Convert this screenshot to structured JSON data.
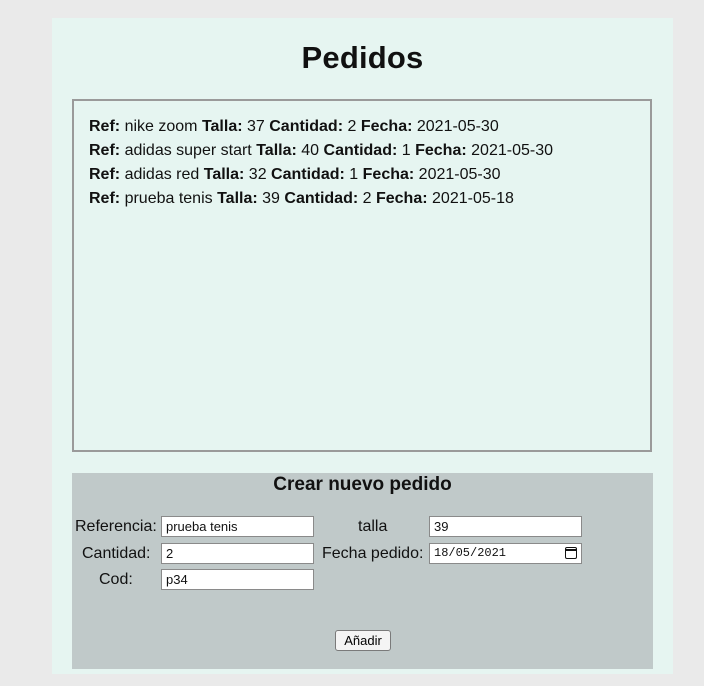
{
  "page": {
    "title": "Pedidos"
  },
  "orders": [
    {
      "ref_label": "Ref:",
      "ref": "nike zoom",
      "talla_label": "Talla:",
      "talla": "37",
      "cantidad_label": "Cantidad:",
      "cantidad": "2",
      "fecha_label": "Fecha:",
      "fecha": "2021-05-30"
    },
    {
      "ref_label": "Ref:",
      "ref": "adidas super start",
      "talla_label": "Talla:",
      "talla": "40",
      "cantidad_label": "Cantidad:",
      "cantidad": "1",
      "fecha_label": "Fecha:",
      "fecha": "2021-05-30"
    },
    {
      "ref_label": "Ref:",
      "ref": "adidas red",
      "talla_label": "Talla:",
      "talla": "32",
      "cantidad_label": "Cantidad:",
      "cantidad": "1",
      "fecha_label": "Fecha:",
      "fecha": "2021-05-30"
    },
    {
      "ref_label": "Ref:",
      "ref": "prueba tenis",
      "talla_label": "Talla:",
      "talla": "39",
      "cantidad_label": "Cantidad:",
      "cantidad": "2",
      "fecha_label": "Fecha:",
      "fecha": "2021-05-18"
    }
  ],
  "form": {
    "title": "Crear nuevo pedido",
    "referencia_label": "Referencia:",
    "referencia_value": "prueba tenis",
    "talla_label": "talla",
    "talla_value": "39",
    "cantidad_label": "Cantidad:",
    "cantidad_value": "2",
    "fecha_label": "Fecha pedido:",
    "fecha_value": "18/05/2021",
    "cod_label": "Cod:",
    "cod_value": "p34",
    "submit_label": "Añadir",
    "calendar_icon": "calendar-icon"
  },
  "colors": {
    "page_background": "#eaeaea",
    "container_background": "#e6f5f1",
    "form_panel_background": "#c0c9c9",
    "list_border": "#9a9a9a"
  }
}
